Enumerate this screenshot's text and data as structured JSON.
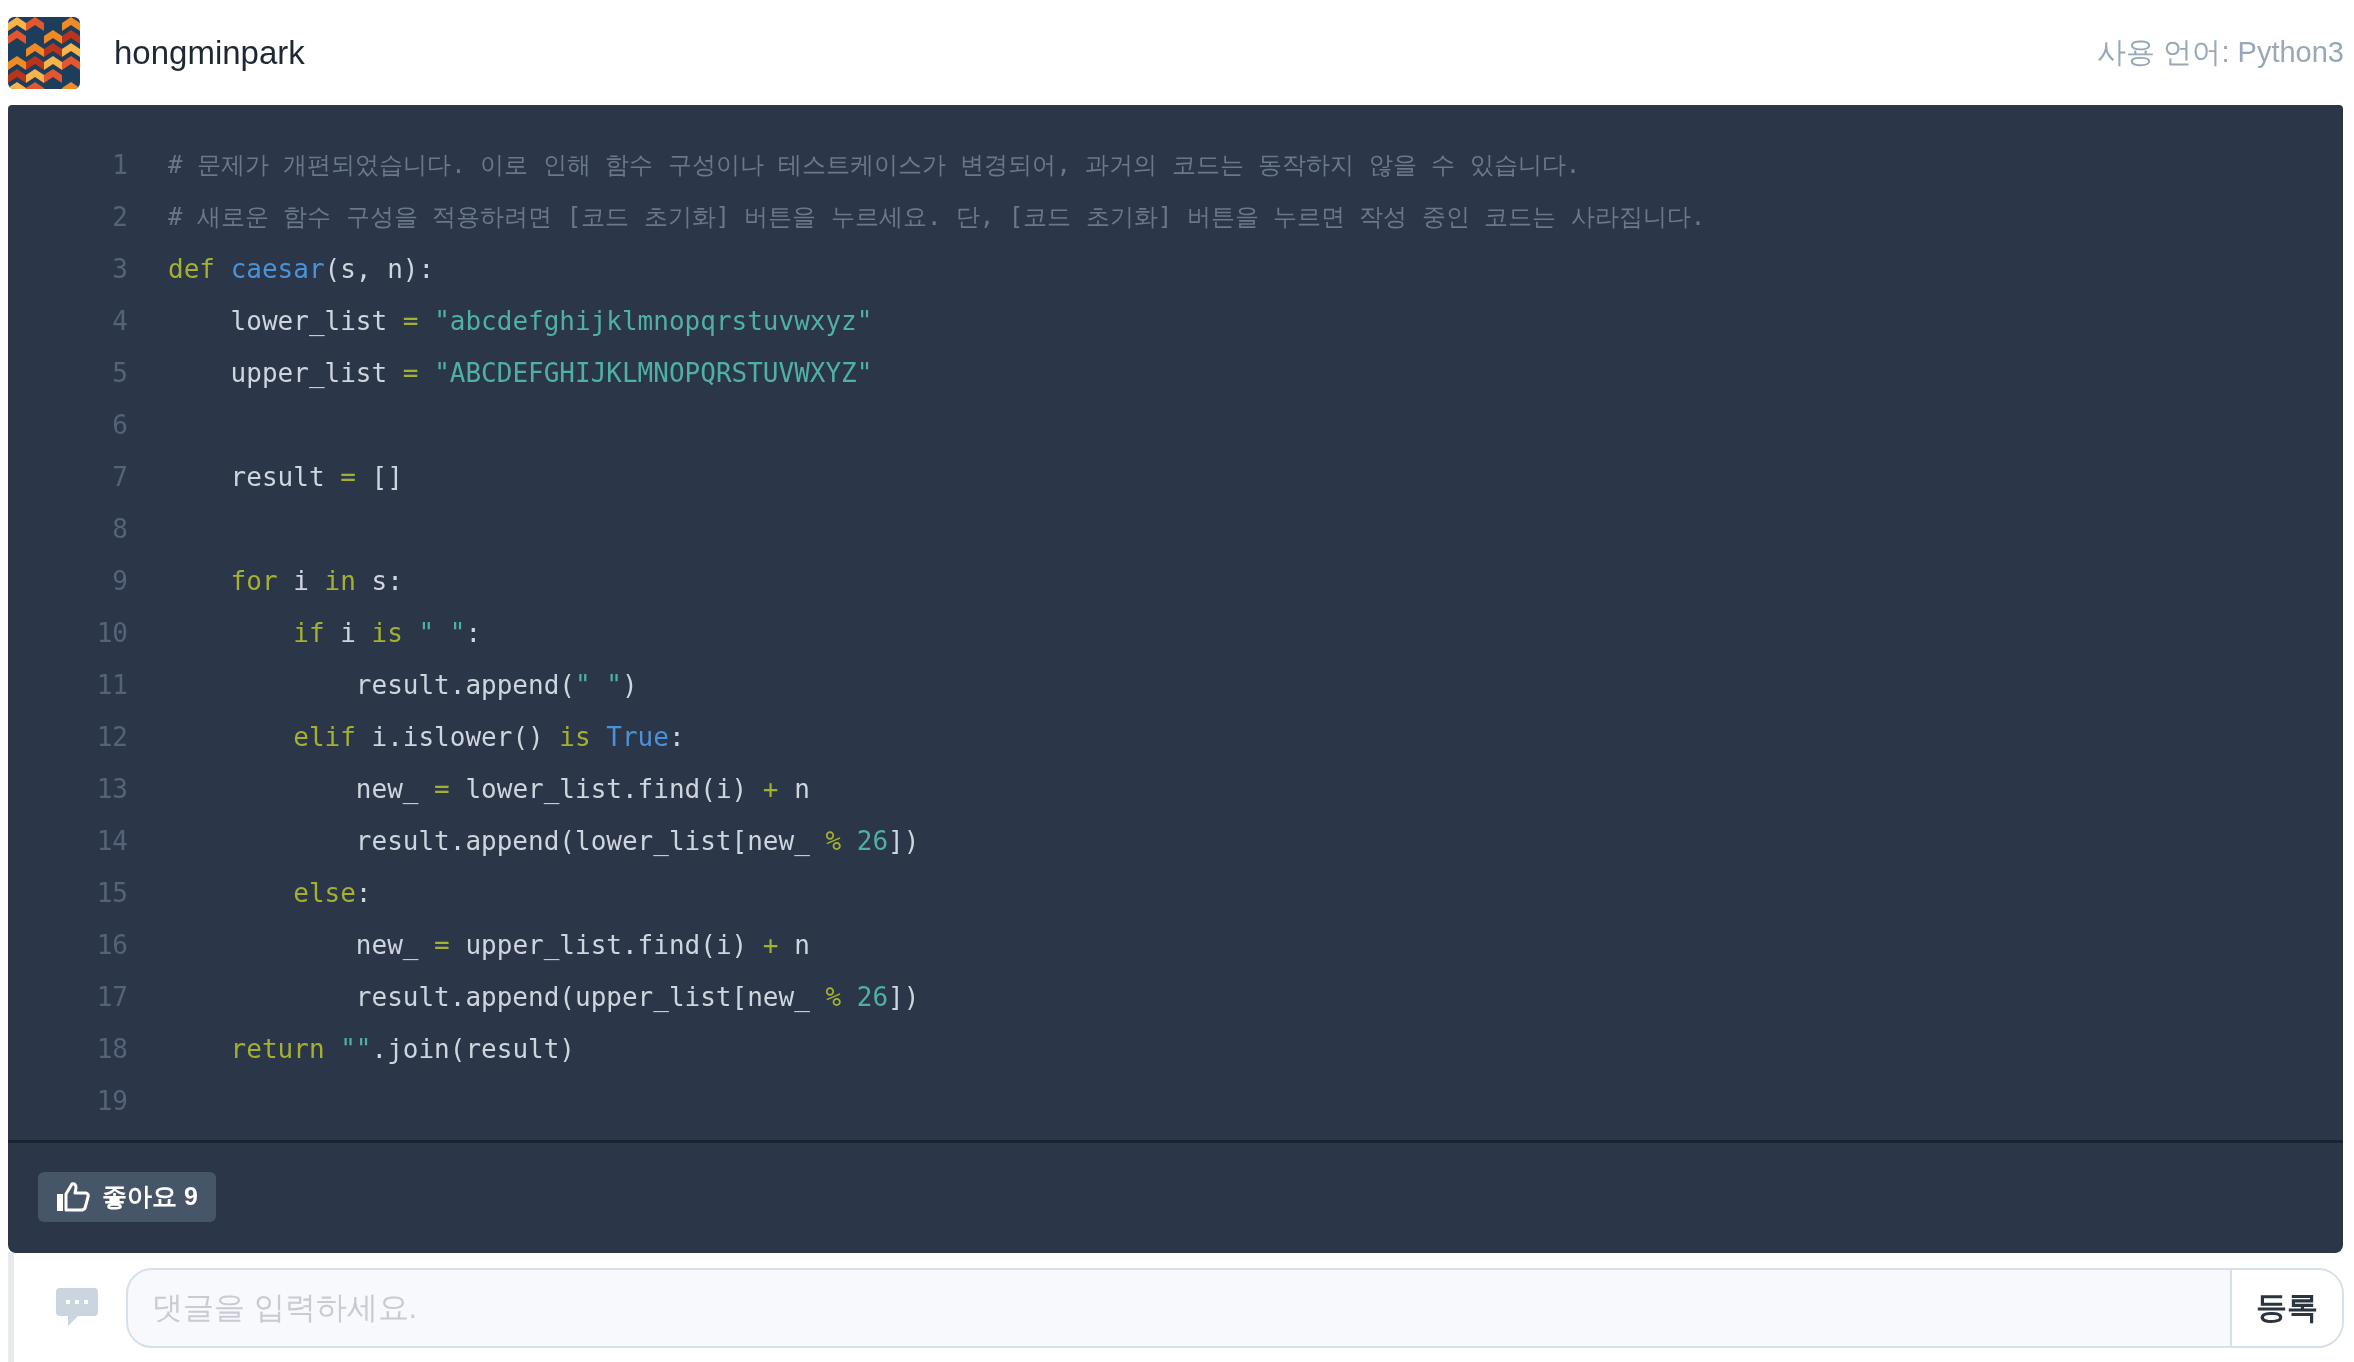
{
  "author": {
    "name": "hongminpark",
    "language": "사용 언어: Python3"
  },
  "code": {
    "lines": [
      {
        "number": "1",
        "tokens": [
          {
            "kind": "comment",
            "text": "# 문제가 개편되었습니다. 이로 인해 함수 구성이나 테스트케이스가 변경되어, 과거의 코드는 동작하지 않을 수 있습니다."
          }
        ]
      },
      {
        "number": "2",
        "tokens": [
          {
            "kind": "comment",
            "text": "# 새로운 함수 구성을 적용하려면 [코드 초기화] 버튼을 누르세요. 단, [코드 초기화] 버튼을 누르면 작성 중인 코드는 사라집니다."
          }
        ]
      },
      {
        "number": "3",
        "tokens": [
          {
            "kind": "keyword",
            "text": "def "
          },
          {
            "kind": "function",
            "text": "caesar"
          },
          {
            "kind": "plain",
            "text": "(s, n):"
          }
        ]
      },
      {
        "number": "4",
        "tokens": [
          {
            "kind": "plain",
            "text": "    lower_list "
          },
          {
            "kind": "operator",
            "text": "= "
          },
          {
            "kind": "string",
            "text": "\"abcdefghijklmnopqrstuvwxyz\""
          }
        ]
      },
      {
        "number": "5",
        "tokens": [
          {
            "kind": "plain",
            "text": "    upper_list "
          },
          {
            "kind": "operator",
            "text": "= "
          },
          {
            "kind": "string",
            "text": "\"ABCDEFGHIJKLMNOPQRSTUVWXYZ\""
          }
        ]
      },
      {
        "number": "6"
      },
      {
        "number": "7",
        "tokens": [
          {
            "kind": "plain",
            "text": "    result "
          },
          {
            "kind": "operator",
            "text": "= "
          },
          {
            "kind": "plain",
            "text": "[]"
          }
        ]
      },
      {
        "number": "8"
      },
      {
        "number": "9",
        "tokens": [
          {
            "kind": "keyword",
            "text": "    for "
          },
          {
            "kind": "plain",
            "text": "i "
          },
          {
            "kind": "keyword",
            "text": "in "
          },
          {
            "kind": "plain",
            "text": "s:"
          }
        ]
      },
      {
        "number": "10",
        "tokens": [
          {
            "kind": "keyword",
            "text": "        if "
          },
          {
            "kind": "plain",
            "text": "i "
          },
          {
            "kind": "keyword",
            "text": "is "
          },
          {
            "kind": "string",
            "text": "\" \""
          },
          {
            "kind": "plain",
            "text": ":"
          }
        ]
      },
      {
        "number": "11",
        "tokens": [
          {
            "kind": "plain",
            "text": "            result.append("
          },
          {
            "kind": "string",
            "text": "\" \""
          },
          {
            "kind": "plain",
            "text": ")"
          }
        ]
      },
      {
        "number": "12",
        "tokens": [
          {
            "kind": "keyword",
            "text": "        elif "
          },
          {
            "kind": "plain",
            "text": "i.islower() "
          },
          {
            "kind": "keyword",
            "text": "is "
          },
          {
            "kind": "builtin",
            "text": "True"
          },
          {
            "kind": "plain",
            "text": ":"
          }
        ]
      },
      {
        "number": "13",
        "tokens": [
          {
            "kind": "plain",
            "text": "            new_ "
          },
          {
            "kind": "operator",
            "text": "= "
          },
          {
            "kind": "plain",
            "text": "lower_list.find(i) "
          },
          {
            "kind": "operator",
            "text": "+ "
          },
          {
            "kind": "plain",
            "text": "n"
          }
        ]
      },
      {
        "number": "14",
        "tokens": [
          {
            "kind": "plain",
            "text": "            result.append(lower_list[new_ "
          },
          {
            "kind": "operator",
            "text": "% "
          },
          {
            "kind": "number",
            "text": "26"
          },
          {
            "kind": "plain",
            "text": "])"
          }
        ]
      },
      {
        "number": "15",
        "tokens": [
          {
            "kind": "keyword",
            "text": "        else"
          },
          {
            "kind": "plain",
            "text": ":"
          }
        ]
      },
      {
        "number": "16",
        "tokens": [
          {
            "kind": "plain",
            "text": "            new_ "
          },
          {
            "kind": "operator",
            "text": "= "
          },
          {
            "kind": "plain",
            "text": "upper_list.find(i) "
          },
          {
            "kind": "operator",
            "text": "+ "
          },
          {
            "kind": "plain",
            "text": "n"
          }
        ]
      },
      {
        "number": "17",
        "tokens": [
          {
            "kind": "plain",
            "text": "            result.append(upper_list[new_ "
          },
          {
            "kind": "operator",
            "text": "% "
          },
          {
            "kind": "number",
            "text": "26"
          },
          {
            "kind": "plain",
            "text": "])"
          }
        ]
      },
      {
        "number": "18",
        "tokens": [
          {
            "kind": "keyword",
            "text": "    return "
          },
          {
            "kind": "string",
            "text": "\"\""
          },
          {
            "kind": "plain",
            "text": ".join(result)"
          }
        ]
      },
      {
        "number": "19"
      }
    ]
  },
  "like_button": {
    "label": "좋아요 9"
  },
  "comment": {
    "placeholder": "댓글을 입력하세요.",
    "submit": "등록"
  }
}
